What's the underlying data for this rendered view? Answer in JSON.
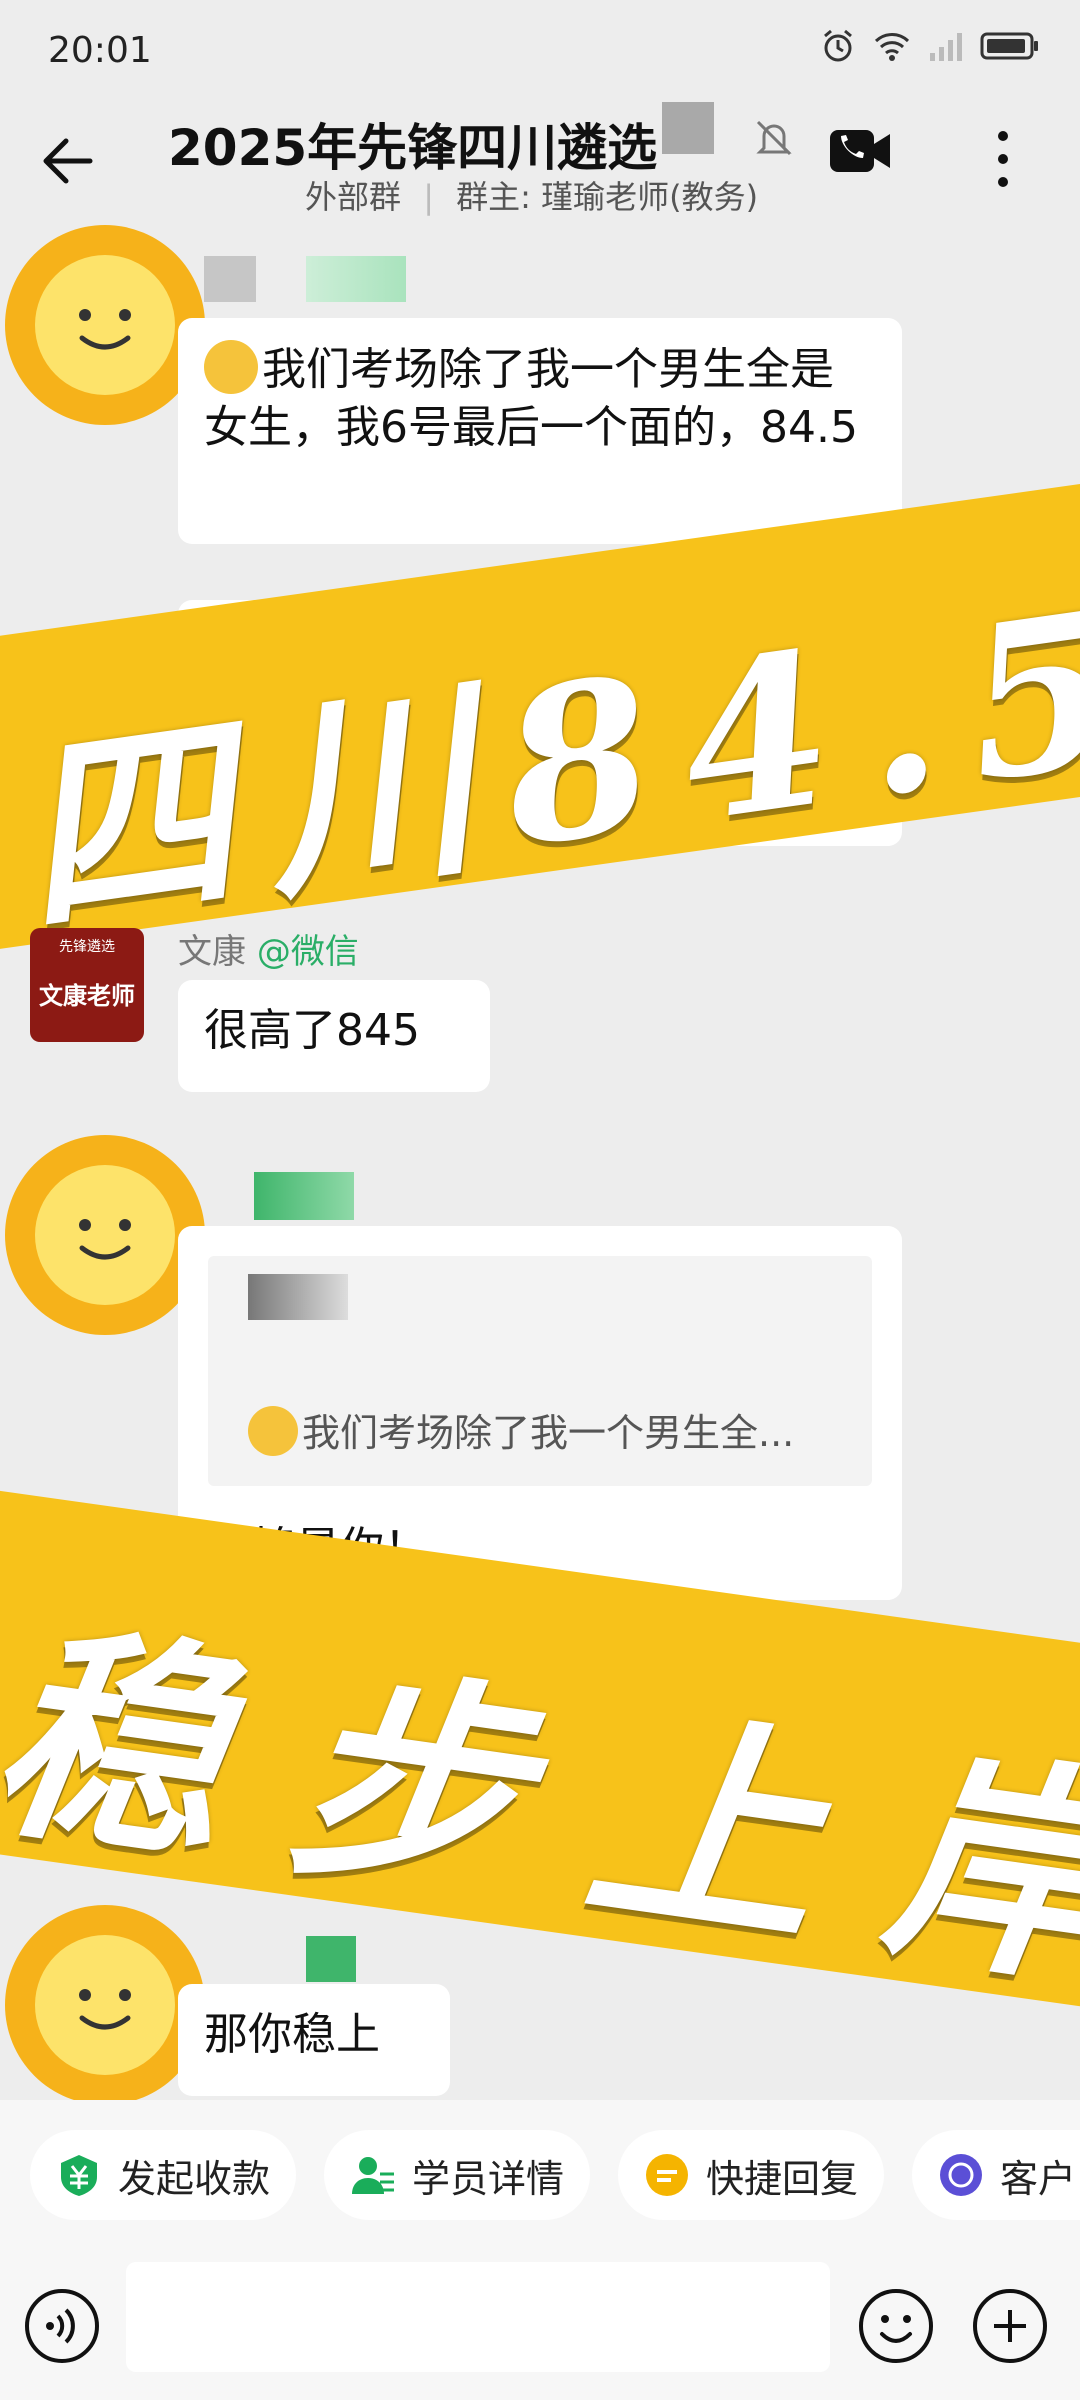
{
  "status": {
    "time": "20:01"
  },
  "header": {
    "title": "2025年先锋四川遴选",
    "subtitle_type": "外部群",
    "subtitle_owner": "群主: 瑾瑜老师(教务)"
  },
  "messages": [
    {
      "text": "我们考场除了我一个男生全是女生，我6号最后一个面的，84.5"
    },
    {
      "sender": "文康",
      "sender_tag": "@微信",
      "avatar_text_top": "先锋遴选",
      "avatar_text": "文康老师",
      "text": "很高了845"
    },
    {
      "quote": "我们考场除了我一个男生全...",
      "text": "不愧是你！"
    },
    {
      "text": "那你稳上"
    }
  ],
  "banners": [
    {
      "text": "四川84.5"
    },
    {
      "text": "稳步上岸"
    }
  ],
  "quick_actions": [
    {
      "label": "发起收款",
      "icon": "yuan-payment-icon",
      "color": "#1aad5a"
    },
    {
      "label": "学员详情",
      "icon": "user-detail-icon",
      "color": "#1aad5a"
    },
    {
      "label": "快捷回复",
      "icon": "quick-reply-icon",
      "color": "#f5b400"
    },
    {
      "label": "客户",
      "icon": "customer-icon",
      "color": "#5b4fd6"
    }
  ],
  "colors": {
    "banner": "#f7c21a",
    "accent_green": "#2aae67",
    "teacher_avatar": "#8c1a14"
  }
}
